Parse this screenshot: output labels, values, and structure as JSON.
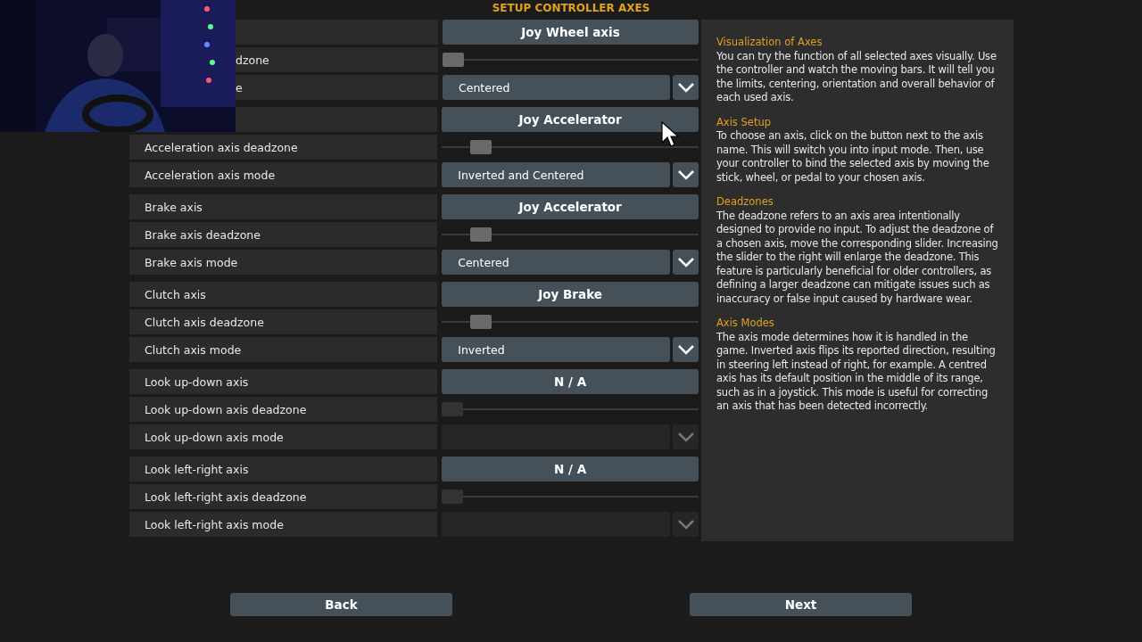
{
  "title": "SETUP CONTROLLER AXES",
  "groups": [
    {
      "axis_value": "Joy Wheel axis",
      "deadzone_label": "dzone",
      "level": 0.0,
      "mode_label": "e",
      "mode_value": "Centered",
      "disabled": false
    },
    {
      "axis_value": "Joy Accelerator",
      "deadzone_label": "Acceleration axis deadzone",
      "level": 0.12,
      "mode_label": "Acceleration axis mode",
      "mode_value": "Inverted and Centered",
      "disabled": false
    },
    {
      "axis_label": "Brake axis",
      "axis_value": "Joy Accelerator",
      "deadzone_label": "Brake axis deadzone",
      "level": 0.12,
      "mode_label": "Brake axis mode",
      "mode_value": "Centered",
      "disabled": false
    },
    {
      "axis_label": "Clutch axis",
      "axis_value": "Joy Brake",
      "deadzone_label": "Clutch axis deadzone",
      "level": 0.12,
      "mode_label": "Clutch axis mode",
      "mode_value": "Inverted",
      "disabled": false
    },
    {
      "axis_label": "Look up-down axis",
      "axis_value": "N / A",
      "deadzone_label": "Look up-down axis deadzone",
      "level": 0.0,
      "mode_label": "Look up-down axis mode",
      "disabled": true
    },
    {
      "axis_label": "Look left-right axis",
      "axis_value": "N / A",
      "deadzone_label": "Look left-right axis deadzone",
      "level": 0.0,
      "mode_label": "Look left-right axis mode",
      "disabled": true
    }
  ],
  "help": [
    {
      "heading": "Visualization of Axes",
      "text": "You can try the function of all selected axes visually. Use the controller and watch the moving bars. It will tell you the limits, centering, orientation and overall behavior of each used axis."
    },
    {
      "heading": "Axis Setup",
      "text": "To choose an axis, click on the button next to the axis name. This will switch you into input mode. Then, use your controller to bind the selected axis by moving the stick, wheel, or pedal to your chosen axis."
    },
    {
      "heading": "Deadzones",
      "text": "The deadzone refers to an axis area intentionally designed to provide no input. To adjust the deadzone of a chosen axis, move the corresponding slider. Increasing the slider to the right will enlarge the deadzone. This feature is particularly beneficial for older controllers, as defining a larger deadzone can mitigate issues such as inaccuracy or false input caused by hardware wear."
    },
    {
      "heading": "Axis Modes",
      "text": "The axis mode determines how it is handled in the game. Inverted axis flips its reported direction, resulting in steering left instead of right, for example. A centred axis has its default position in the middle of its range, such as in a joystick. This mode is useful for correcting an axis that has been detected incorrectly."
    }
  ],
  "buttons": [
    "Back",
    "Next"
  ]
}
